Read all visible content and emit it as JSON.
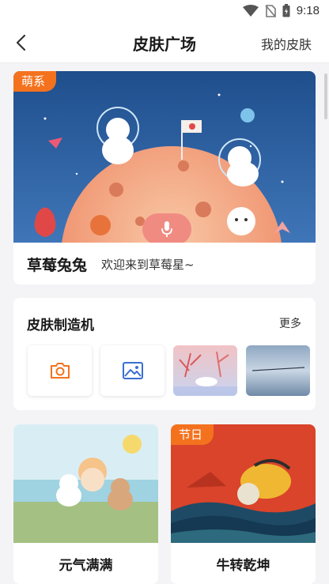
{
  "status": {
    "time": "9:18"
  },
  "nav": {
    "title": "皮肤广场",
    "right_label": "我的皮肤"
  },
  "hero": {
    "tag": "萌系",
    "name": "草莓兔兔",
    "desc": "欢迎来到草莓星~"
  },
  "maker": {
    "title": "皮肤制造机",
    "more": "更多"
  },
  "skins": [
    {
      "label": "元气满满"
    },
    {
      "label": "牛转乾坤",
      "tag": "节日"
    }
  ],
  "icons": [
    "back-arrow-icon",
    "camera-icon",
    "image-icon",
    "microphone-icon",
    "wifi-icon",
    "battery-icon"
  ],
  "colors": {
    "accent": "#f4721e",
    "icon_orange": "#f4721e",
    "icon_blue": "#3a6fd1"
  }
}
